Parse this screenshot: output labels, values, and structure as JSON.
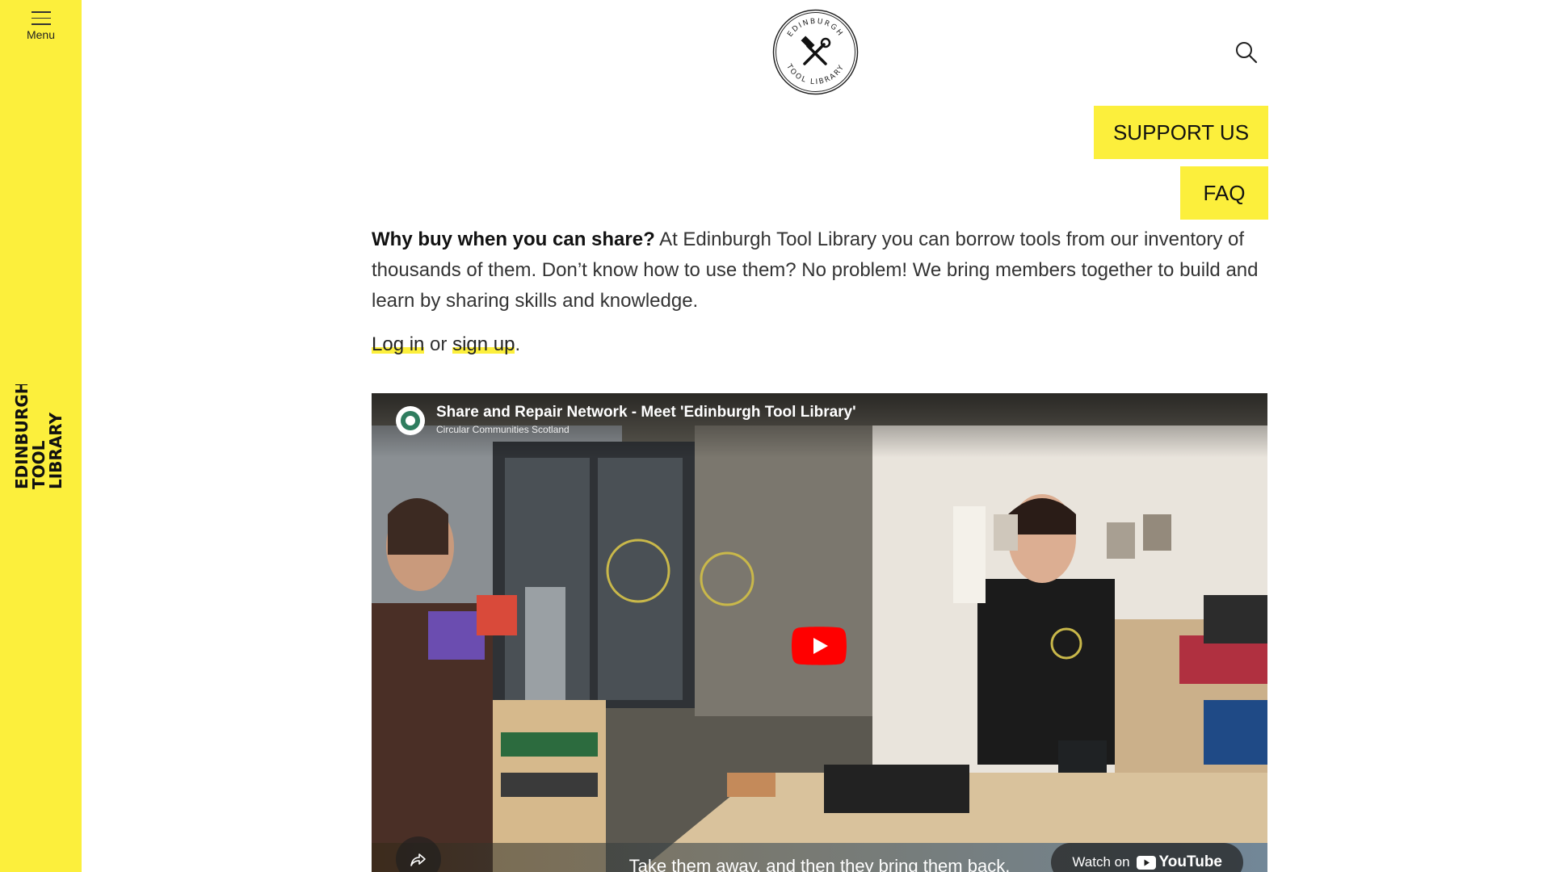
{
  "sidebar": {
    "menu_label": "Menu",
    "logo_lines": [
      "EDINBURGH",
      "TOOL",
      "LIBRARY"
    ]
  },
  "header": {
    "logo_text_top": "EDINBURGH",
    "logo_text_bottom": "TOOL LIBRARY",
    "search_icon": "search-icon"
  },
  "actions": {
    "support_label": "SUPPORT US",
    "faq_label": "FAQ"
  },
  "intro": {
    "bold": "Why buy when you can share?",
    "text": " At Edinburgh Tool Library you can borrow tools from our inventory of thousands of them. Don’t know how to use them? No problem! We bring members together to build and learn by sharing skills and knowledge."
  },
  "auth": {
    "login": "Log in",
    "or": " or ",
    "signup": "sign up",
    "period": "."
  },
  "video": {
    "title": "Share and Repair Network - Meet 'Edinburgh Tool Library'",
    "channel": "Circular Communities Scotland",
    "caption": "Take them away, and then they bring them back.",
    "watch_on": "Watch on",
    "youtube": "YouTube"
  },
  "colors": {
    "accent": "#fcef3c",
    "text": "#222222"
  }
}
